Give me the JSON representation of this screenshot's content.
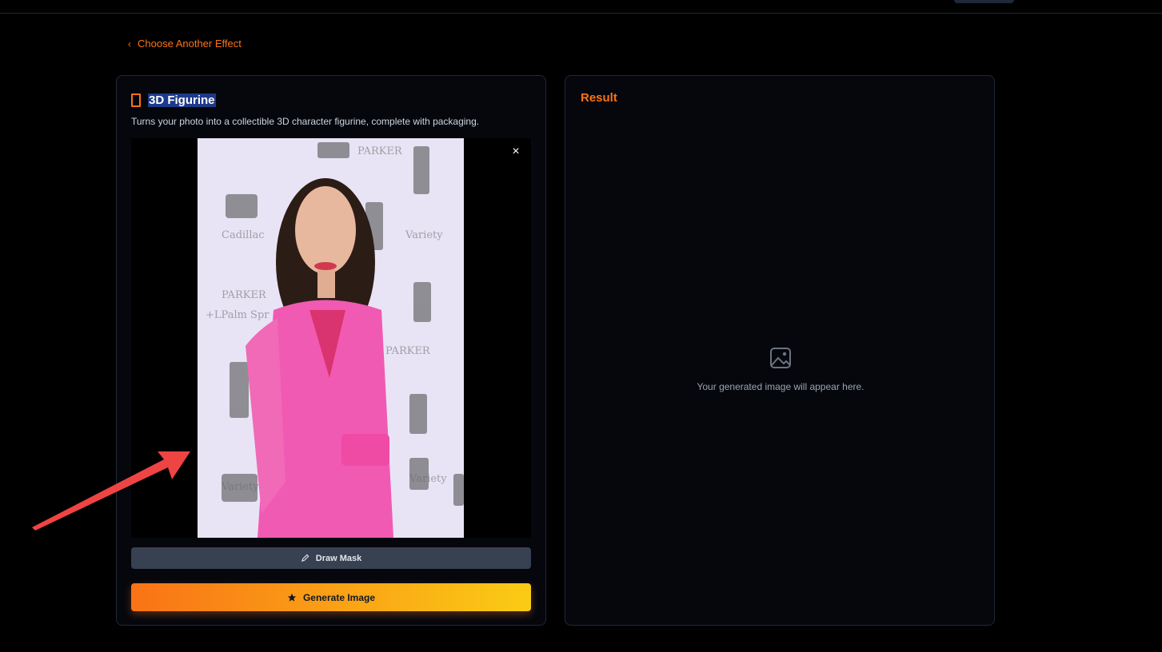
{
  "nav": {
    "back_label": "Choose Another Effect"
  },
  "effect": {
    "title": "3D Figurine",
    "description": "Turns your photo into a collectible 3D character figurine, complete with packaging."
  },
  "upload": {
    "close_label": "×",
    "has_image": true
  },
  "actions": {
    "draw_mask_label": "Draw Mask",
    "generate_label": "Generate Image"
  },
  "result": {
    "title": "Result",
    "placeholder_text": "Your generated image will appear here."
  },
  "colors": {
    "accent": "#f97316",
    "accent_end": "#facc15",
    "card_bg": "#05070d",
    "annotation_arrow": "#ef4444"
  },
  "icons": {
    "back": "chevron-left-icon",
    "title": "phone-icon",
    "close": "close-icon",
    "draw_mask": "pencil-icon",
    "generate": "star-icon",
    "placeholder": "image-icon"
  }
}
